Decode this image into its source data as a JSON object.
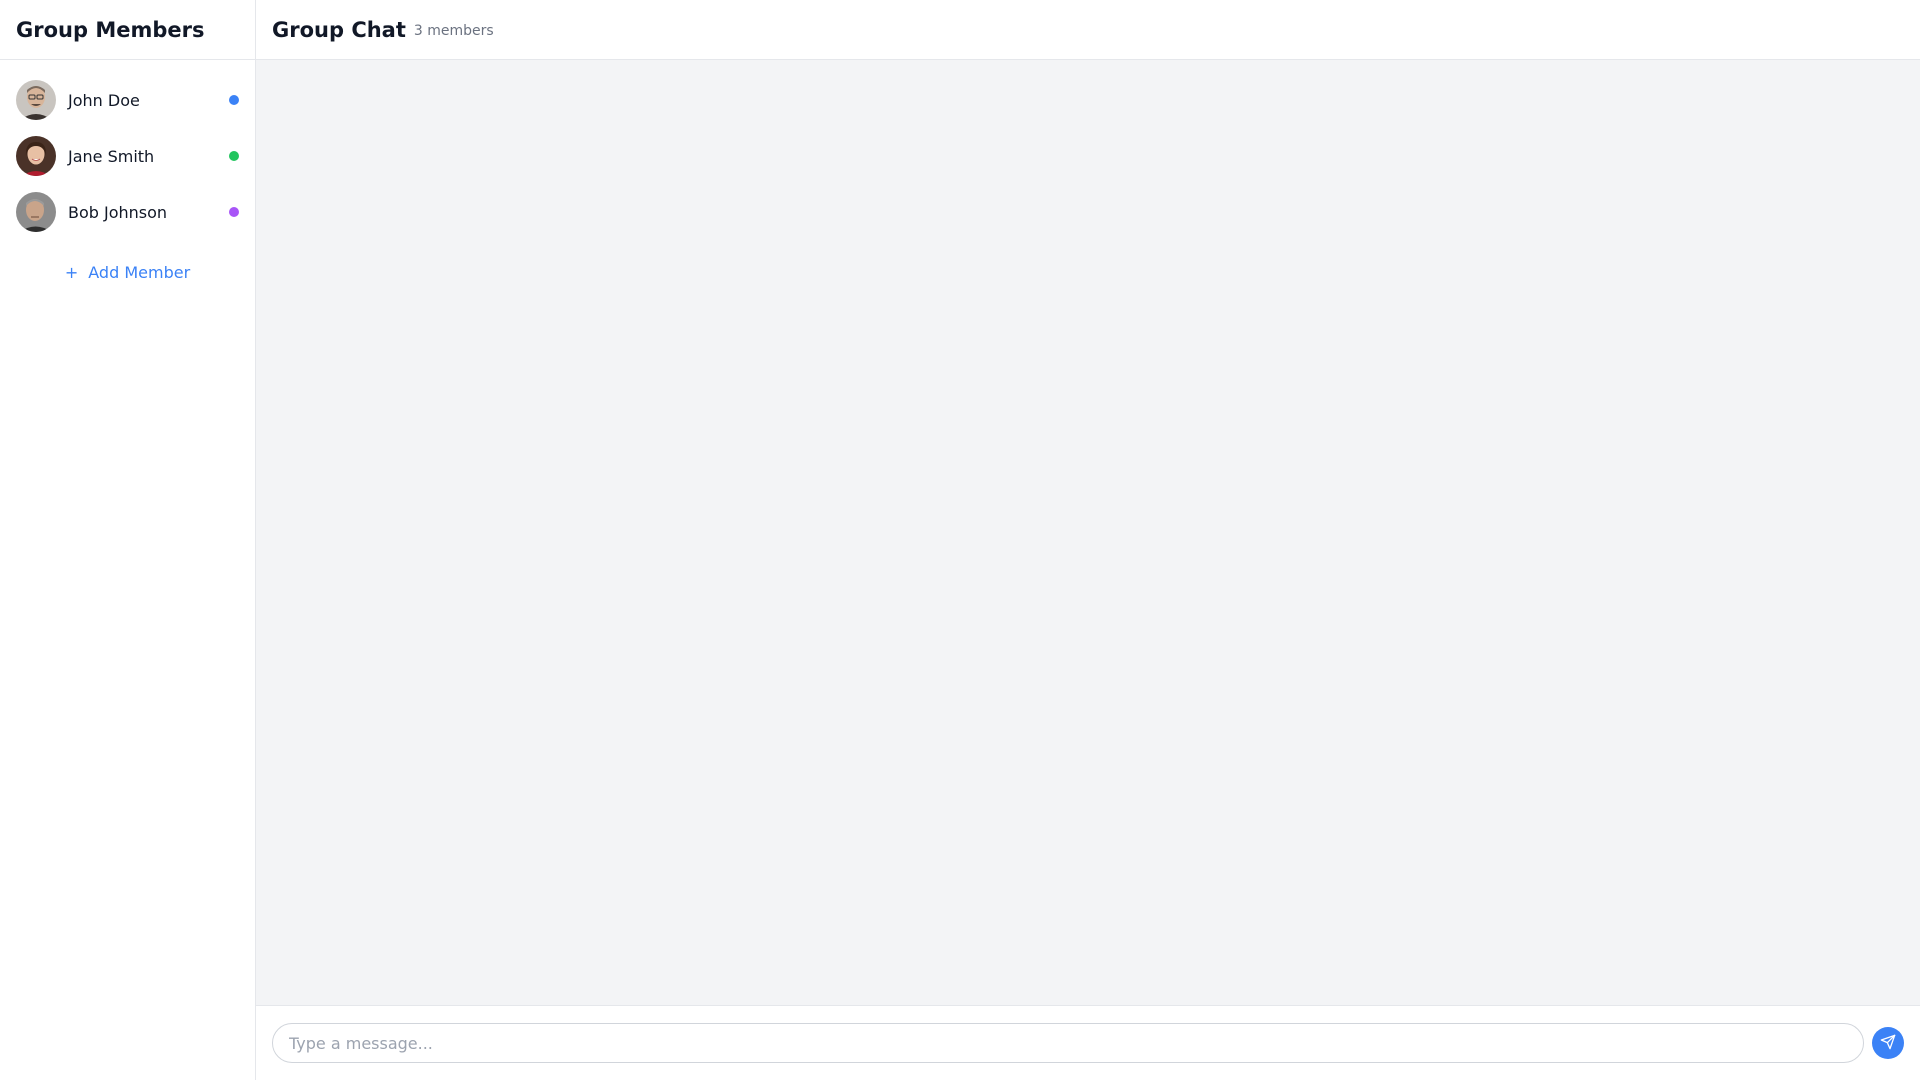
{
  "sidebar": {
    "title": "Group Members",
    "members": [
      {
        "name": "John Doe",
        "status_color": "#3b82f6",
        "avatar": "john-doe-avatar"
      },
      {
        "name": "Jane Smith",
        "status_color": "#22c55e",
        "avatar": "jane-smith-avatar"
      },
      {
        "name": "Bob Johnson",
        "status_color": "#a855f7",
        "avatar": "bob-johnson-avatar"
      }
    ],
    "add_member_icon": "+",
    "add_member_label": "Add Member"
  },
  "header": {
    "title": "Group Chat",
    "member_count": "3 members"
  },
  "composer": {
    "placeholder": "Type a message...",
    "send_icon": "send-icon"
  },
  "colors": {
    "accent": "#3b82f6",
    "chat_background": "#f3f4f6"
  }
}
